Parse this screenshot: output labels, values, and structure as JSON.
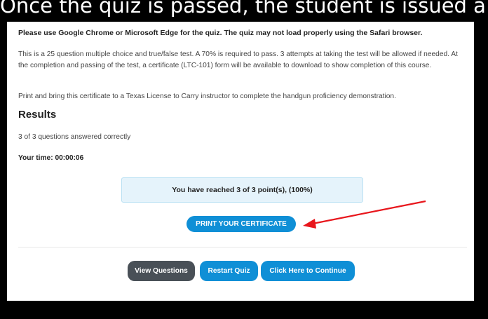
{
  "caption": "Once the quiz is passed, the student is issued a c",
  "notice": "Please use Google Chrome or Microsoft Edge for the quiz. The quiz may not load properly using the Safari browser.",
  "intro": "This is a 25 question multiple choice and true/false test. A 70% is required to pass. 3 attempts at taking the test will be allowed if needed. At the completion and passing of the test, a certificate (LTC-101) form will be available to download to show completion of this course.",
  "instruction": "Print and bring this certificate to a Texas License to Carry instructor to complete the handgun proficiency demonstration.",
  "results": {
    "heading": "Results",
    "answered": "3 of 3 questions answered correctly",
    "time": "Your time: 00:00:06",
    "score": "You have reached 3 of 3 point(s), (100%)"
  },
  "buttons": {
    "print": "PRINT YOUR CERTIFICATE",
    "view": "View Questions",
    "restart": "Restart Quiz",
    "continue": "Click Here to Continue"
  },
  "colors": {
    "primary": "#0f8fd6",
    "secondary": "#495057",
    "score_bg": "#e5f3fb",
    "arrow": "#e8161c"
  }
}
